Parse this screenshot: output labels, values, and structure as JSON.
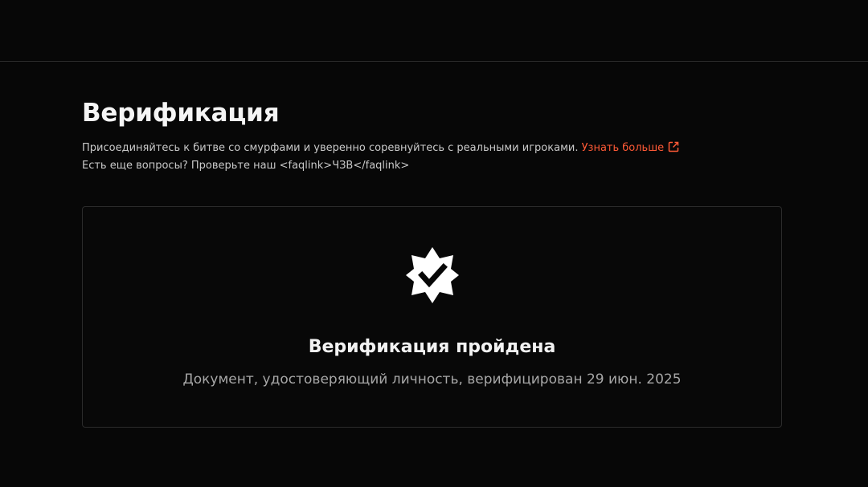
{
  "header": {},
  "verification": {
    "title": "Верификация",
    "description": "Присоединяйтесь к битве со смурфами и уверенно соревнуйтесь с реальными игроками.",
    "learn_more_label": "Узнать больше",
    "faq_text": "Есть еще вопросы? Проверьте наш <faqlink>ЧЗВ</faqlink>"
  },
  "status_card": {
    "icon": "verified-badge-icon",
    "title": "Верификация пройдена",
    "subtitle": "Документ, удостоверяющий личность, верифицирован 29 июн. 2025"
  },
  "colors": {
    "background": "#070707",
    "accent": "#ff5a36",
    "border": "#2b2b2b"
  }
}
